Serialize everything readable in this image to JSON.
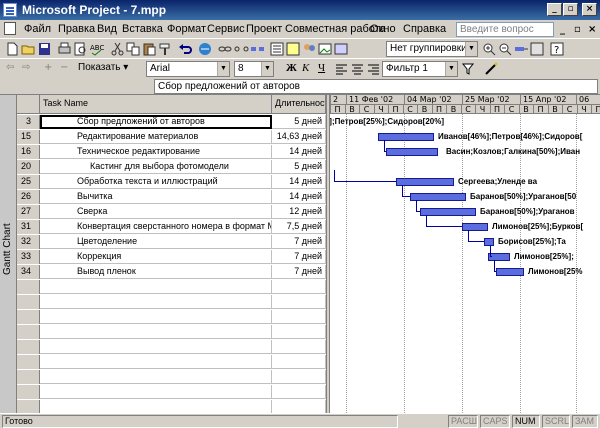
{
  "window": {
    "title": "Microsoft Project - 7.mpp"
  },
  "menu": {
    "items": [
      "Файл",
      "Правка",
      "Вид",
      "Вставка",
      "Формат",
      "Сервис",
      "Проект",
      "Совместная работа",
      "Окно",
      "Справка"
    ],
    "help_placeholder": "Введите вопрос"
  },
  "toolbar1": {
    "grouping": "Нет группировки"
  },
  "toolbar2": {
    "show_label": "Показать",
    "font": "Arial",
    "size": "8",
    "filter": "Фильтр 1",
    "bold": "Ж",
    "italic": "К",
    "underline": "Ч"
  },
  "entry_bar": {
    "value": "Сбор предложений от авторов"
  },
  "sidebar": {
    "label": "Gantt Chart"
  },
  "grid": {
    "headers": [
      "Task Name",
      "Длительность"
    ],
    "rows": [
      {
        "id": "3",
        "name": "Сбор предложений от авторов",
        "duration": "5 дней",
        "indent": 1
      },
      {
        "id": "15",
        "name": "Редактирование материалов",
        "duration": "14,63 дней",
        "indent": 1
      },
      {
        "id": "16",
        "name": "Техническое редактирование",
        "duration": "14 дней",
        "indent": 1
      },
      {
        "id": "20",
        "name": "Кастинг для выбора фотомодели",
        "duration": "5 дней",
        "indent": 2
      },
      {
        "id": "25",
        "name": "Обработка текста и иллюстраций",
        "duration": "14 дней",
        "indent": 1
      },
      {
        "id": "26",
        "name": "Вычитка",
        "duration": "14 дней",
        "indent": 1
      },
      {
        "id": "27",
        "name": "Сверка",
        "duration": "12 дней",
        "indent": 1
      },
      {
        "id": "31",
        "name": "Конвертация сверстанного номера в формат Mac",
        "duration": "7,5 дней",
        "indent": 1
      },
      {
        "id": "32",
        "name": "Цветоделение",
        "duration": "7 дней",
        "indent": 1
      },
      {
        "id": "33",
        "name": "Коррекция",
        "duration": "7 дней",
        "indent": 1
      },
      {
        "id": "34",
        "name": "Вывод пленок",
        "duration": "7 дней",
        "indent": 1
      }
    ]
  },
  "chart": {
    "weeks": [
      "2",
      "11 Фев '02",
      "04 Мар '02",
      "25 Мар '02",
      "15 Апр '02",
      "06"
    ],
    "days": [
      "П",
      "В",
      "С",
      "Ч",
      "П",
      "С",
      "В",
      "П",
      "В",
      "С",
      "Ч",
      "П",
      "С",
      "В",
      "П",
      "В",
      "С",
      "Ч",
      "П"
    ],
    "bar_color": "#5a6ee0",
    "labels": [
      "дней];Петров[25%];Сидоров[20%]",
      "Иванов[46%];Петров[46%];Сидоров[",
      "Васин;Козлов;Галкина[50%];Иван",
      "",
      "Сергеева;Уленде ва",
      "Баранов[50%];Ураганов[50",
      "Баранов[50%];Ураганов",
      "Лимонов[25%];Бурков[",
      "Борисов[25%];Та",
      "Лимонов[25%];",
      "Лимонов[25%"
    ]
  },
  "status": {
    "ready": "Готово",
    "indicators": [
      "РАСШ",
      "CAPS",
      "NUM",
      "SCRL",
      "ЗАМ"
    ]
  }
}
